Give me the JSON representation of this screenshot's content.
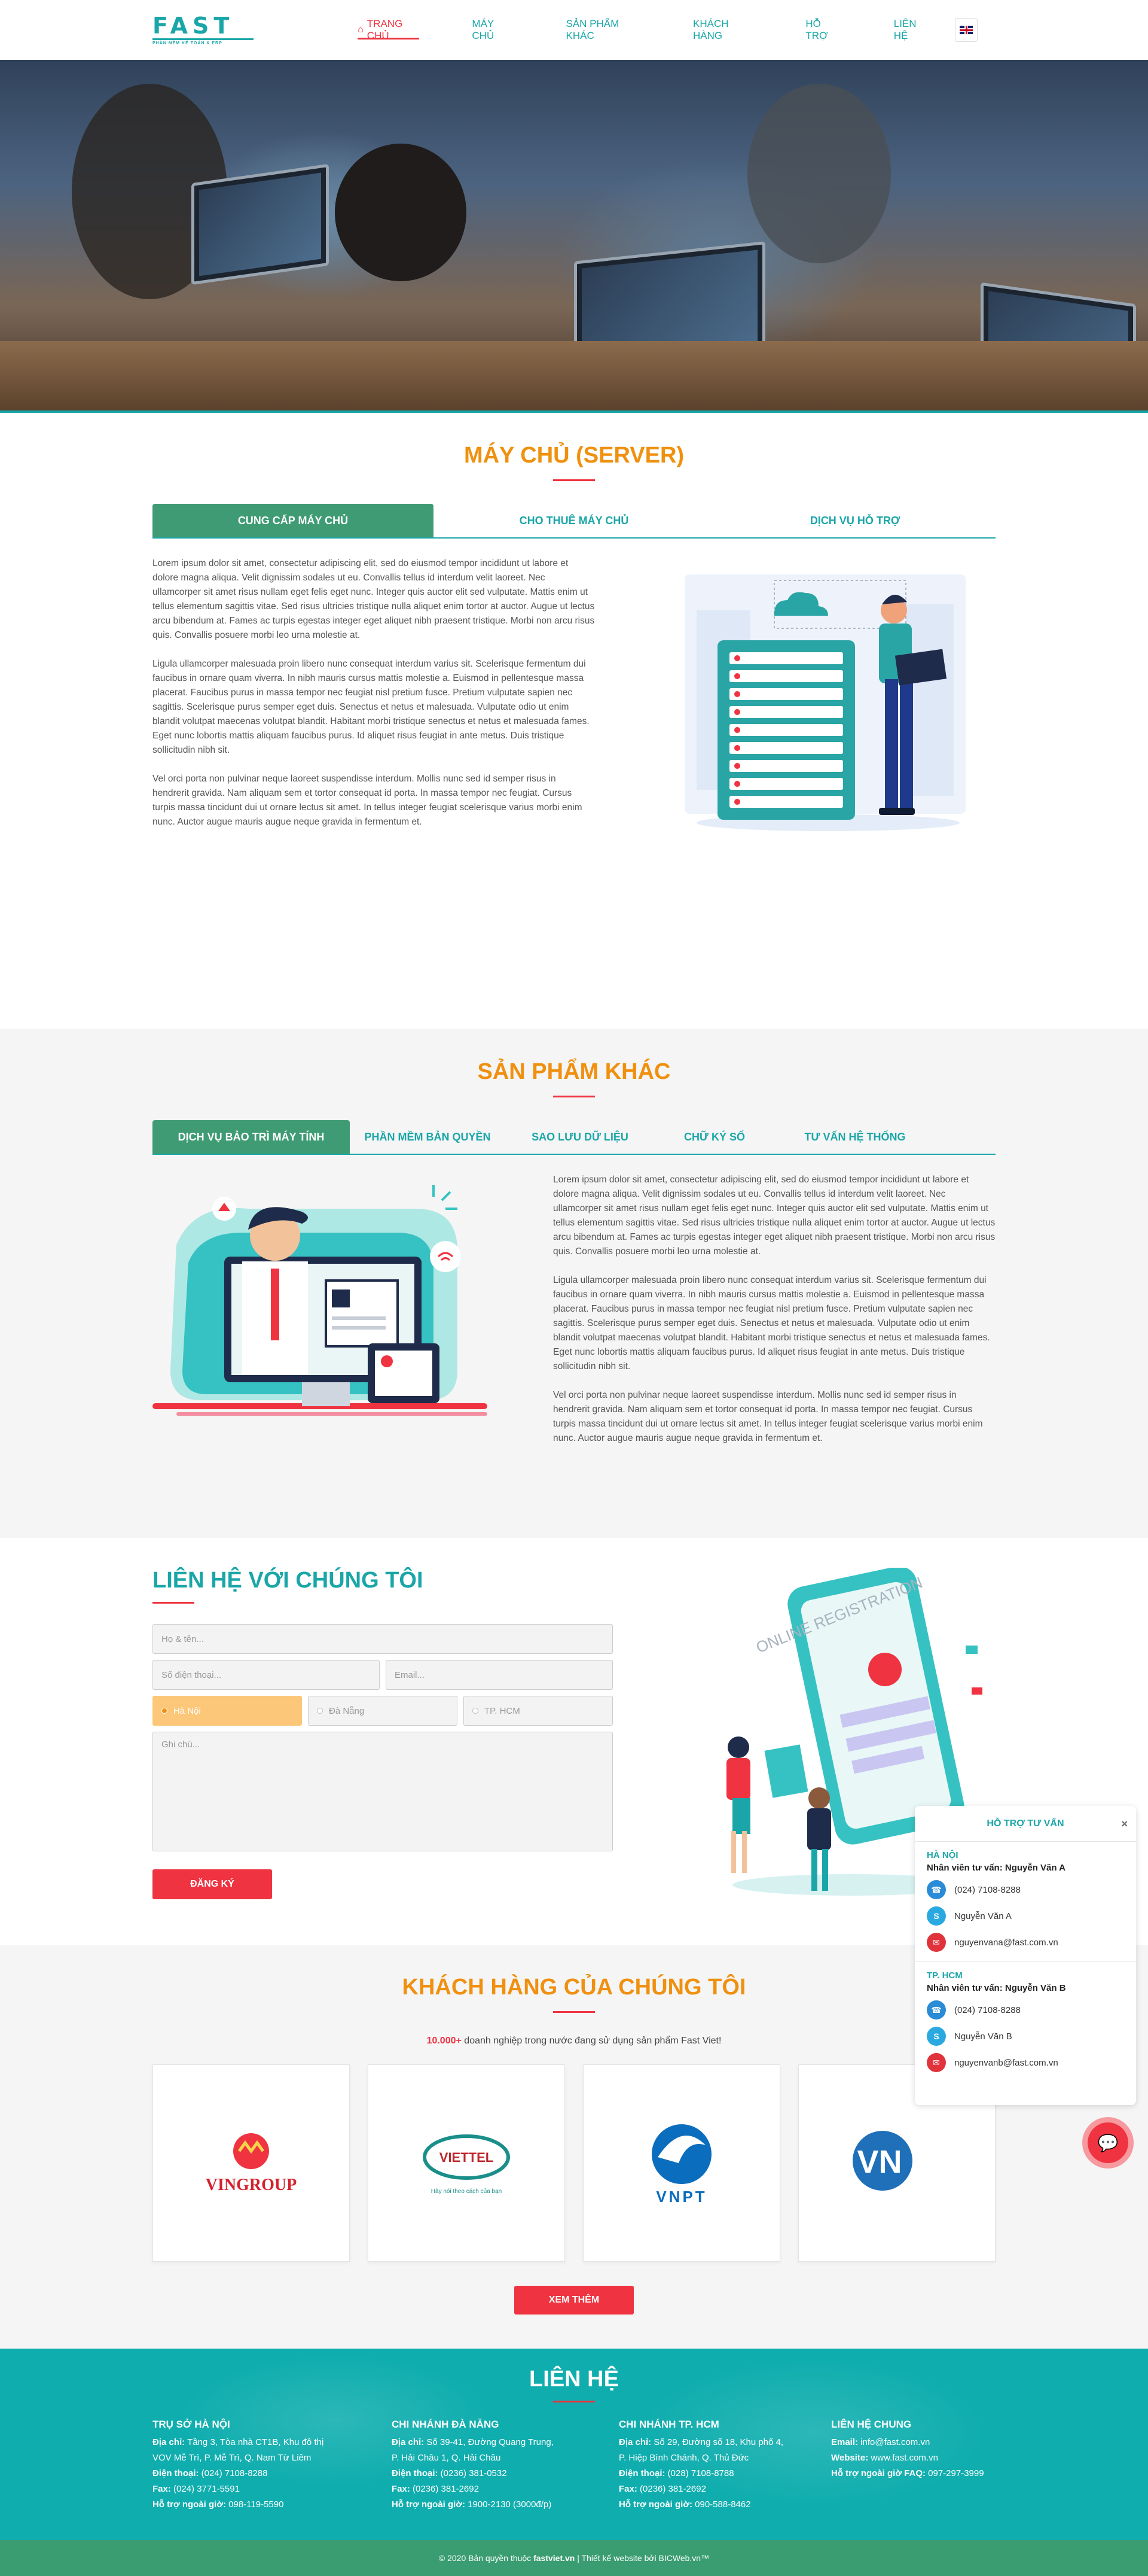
{
  "header": {
    "logo_big": "FAST",
    "logo_small": "PHẦN MỀM KẾ TOÁN & ERP",
    "nav": [
      {
        "label": "TRANG CHỦ",
        "active": true
      },
      {
        "label": "MÁY CHỦ"
      },
      {
        "label": "SẢN PHẨM KHÁC"
      },
      {
        "label": "KHÁCH HÀNG"
      },
      {
        "label": "HỖ TRỢ"
      },
      {
        "label": "LIÊN HỆ"
      }
    ],
    "lang_icon": "uk-flag-icon"
  },
  "server": {
    "title": "MÁY CHỦ (SERVER)",
    "tabs": [
      "CUNG CẤP MÁY CHỦ",
      "CHO THUÊ MÁY CHỦ",
      "DỊCH VỤ HỖ TRỢ"
    ],
    "paragraphs": [
      "Lorem ipsum dolor sit amet, consectetur adipiscing elit, sed do eiusmod tempor incididunt ut labore et dolore magna aliqua. Velit dignissim sodales ut eu. Convallis tellus id interdum velit laoreet. Nec ullamcorper sit amet risus nullam eget felis eget nunc. Integer quis auctor elit sed vulputate. Mattis enim ut tellus elementum sagittis vitae. Sed risus ultricies tristique nulla aliquet enim tortor at auctor. Augue ut lectus arcu bibendum at. Fames ac turpis egestas integer eget aliquet nibh praesent tristique. Morbi non arcu risus quis. Convallis posuere morbi leo urna molestie at.",
      "Ligula ullamcorper malesuada proin libero nunc consequat interdum varius sit. Scelerisque fermentum dui faucibus in ornare quam viverra. In nibh mauris cursus mattis molestie a. Euismod in pellentesque massa placerat. Faucibus purus in massa tempor nec feugiat nisl pretium fusce. Pretium vulputate sapien nec sagittis. Scelerisque purus semper eget duis. Senectus et netus et malesuada. Vulputate odio ut enim blandit volutpat maecenas volutpat blandit. Habitant morbi tristique senectus et netus et malesuada fames. Eget nunc lobortis mattis aliquam faucibus purus. Id aliquet risus feugiat in ante metus. Duis tristique sollicitudin nibh sit.",
      "Vel orci porta non pulvinar neque laoreet suspendisse interdum. Mollis nunc sed id semper risus in hendrerit gravida. Nam aliquam sem et tortor consequat id porta. In massa tempor nec feugiat. Cursus turpis massa tincidunt dui ut ornare lectus sit amet. In tellus integer feugiat scelerisque varius morbi enim nunc. Auctor augue mauris augue neque gravida in fermentum et."
    ]
  },
  "products": {
    "title": "SẢN PHẨM KHÁC",
    "tabs": [
      "DỊCH VỤ BẢO TRÌ MÁY TÍNH",
      "PHẦN MỀM BẢN QUYỀN",
      "SAO LƯU DỮ LIỆU",
      "CHỮ KÝ SỐ",
      "TƯ VẤN HỆ THỐNG"
    ],
    "paragraphs": [
      "Lorem ipsum dolor sit amet, consectetur adipiscing elit, sed do eiusmod tempor incididunt ut labore et dolore magna aliqua. Velit dignissim sodales ut eu. Convallis tellus id interdum velit laoreet. Nec ullamcorper sit amet risus nullam eget felis eget nunc. Integer quis auctor elit sed vulputate. Mattis enim ut tellus elementum sagittis vitae. Sed risus ultricies tristique nulla aliquet enim tortor at auctor. Augue ut lectus arcu bibendum at. Fames ac turpis egestas integer eget aliquet nibh praesent tristique. Morbi non arcu risus quis. Convallis posuere morbi leo urna molestie at.",
      "Ligula ullamcorper malesuada proin libero nunc consequat interdum varius sit. Scelerisque fermentum dui faucibus in ornare quam viverra. In nibh mauris cursus mattis molestie a. Euismod in pellentesque massa placerat. Faucibus purus in massa tempor nec feugiat nisl pretium fusce. Pretium vulputate sapien nec sagittis. Scelerisque purus semper eget duis. Senectus et netus et malesuada. Vulputate odio ut enim blandit volutpat maecenas volutpat blandit. Habitant morbi tristique senectus et netus et malesuada fames. Eget nunc lobortis mattis aliquam faucibus purus. Id aliquet risus feugiat in ante metus. Duis tristique sollicitudin nibh sit.",
      "Vel orci porta non pulvinar neque laoreet suspendisse interdum. Mollis nunc sed id semper risus in hendrerit gravida. Nam aliquam sem et tortor consequat id porta. In massa tempor nec feugiat. Cursus turpis massa tincidunt dui ut ornare lectus sit amet. In tellus integer feugiat scelerisque varius morbi enim nunc. Auctor augue mauris augue neque gravida in fermentum et."
    ]
  },
  "contact": {
    "title": "LIÊN HỆ VỚI CHÚNG TÔI",
    "name_placeholder": "Họ & tên...",
    "phone_placeholder": "Số điện thoại...",
    "email_placeholder": "Email...",
    "city_options": [
      "Hà Nội",
      "Đà Nẵng",
      "TP. HCM"
    ],
    "selected_city": "Hà Nội",
    "note_placeholder": "Ghi chú...",
    "submit_label": "ĐĂNG KÝ",
    "illus_text": "ONLINE REGISTRATION"
  },
  "customers": {
    "title": "KHÁCH HÀNG CỦA CHÚNG TÔI",
    "count": "10.000+",
    "subtitle": " doanh nghiệp trong nước đang sử dụng sản phẩm Fast Viet!",
    "logos": [
      {
        "name": "VINGROUP",
        "icon": "vingroup-logo"
      },
      {
        "name": "VIETTEL",
        "tagline": "Hãy nói theo cách của bạn",
        "icon": "viettel-logo"
      },
      {
        "name": "VNPT",
        "icon": "vnpt-logo"
      },
      {
        "name": "VN",
        "icon": "vn-partial-logo"
      }
    ],
    "more_label": "XEM THÊM"
  },
  "support": {
    "title": "HỖ TRỢ TƯ VẤN",
    "close": "×",
    "groups": [
      {
        "city": "HÀ NỘI",
        "staff": "Nhân viên tư vấn: Nguyễn Văn A",
        "phone": "(024) 7108-8288",
        "skype": "Nguyễn Văn A",
        "email": "nguyenvana@fast.com.vn"
      },
      {
        "city": "TP. HCM",
        "staff": "Nhân viên tư vấn: Nguyễn Văn B",
        "phone": "(024) 7108-8288",
        "skype": "Nguyễn Văn B",
        "email": "nguyenvanb@fast.com.vn"
      }
    ]
  },
  "footer": {
    "title": "LIÊN HỆ",
    "cols": [
      {
        "heading": "TRỤ SỞ HÀ NỘI",
        "lines": [
          {
            "k": "Địa chỉ:",
            "v": " Tầng 3, Tòa nhà CT1B, Khu đô thị"
          },
          {
            "k": "",
            "v": "VOV Mễ Trì, P. Mễ Trì, Q. Nam Từ Liêm"
          },
          {
            "k": "Điện thoại:",
            "v": " (024) 7108-8288"
          },
          {
            "k": "Fax:",
            "v": " (024) 3771-5591"
          },
          {
            "k": "Hỗ trợ ngoài giờ:",
            "v": " 098-119-5590"
          }
        ]
      },
      {
        "heading": "CHI NHÁNH ĐÀ NẴNG",
        "lines": [
          {
            "k": "Địa chỉ:",
            "v": " Số 39-41, Đường Quang Trung,"
          },
          {
            "k": "",
            "v": "P. Hải Châu 1, Q. Hải Châu"
          },
          {
            "k": "Điện thoại:",
            "v": " (0236) 381-0532"
          },
          {
            "k": "Fax:",
            "v": " (0236) 381-2692"
          },
          {
            "k": "Hỗ trợ ngoài giờ:",
            "v": " 1900-2130 (3000đ/p)"
          }
        ]
      },
      {
        "heading": "CHI NHÁNH TP. HCM",
        "lines": [
          {
            "k": "Địa chỉ:",
            "v": " Số 29, Đường số 18, Khu phố 4,"
          },
          {
            "k": "",
            "v": "P. Hiệp Bình Chánh, Q. Thủ Đức"
          },
          {
            "k": "Điện thoại:",
            "v": " (028) 7108-8788"
          },
          {
            "k": "Fax:",
            "v": " (0236) 381-2692"
          },
          {
            "k": "Hỗ trợ ngoài giờ:",
            "v": " 090-588-8462"
          }
        ]
      },
      {
        "heading": "LIÊN HỆ CHUNG",
        "lines": [
          {
            "k": "Email:",
            "v": " info@fast.com.vn"
          },
          {
            "k": "Website:",
            "v": " www.fast.com.vn"
          },
          {
            "k": "Hỗ trợ ngoài giờ FAQ:",
            "v": " 097-297-3999"
          }
        ]
      }
    ],
    "copyright_pre": "© 2020 Bản quyền thuộc ",
    "copyright_brand": "fastviet.vn",
    "copyright_post": "  |  Thiết kế website bởi BICWeb.vn™"
  },
  "colors": {
    "teal": "#1aa6a8",
    "orange": "#f0900f",
    "red": "#ef3340",
    "green": "#3e9b73"
  }
}
